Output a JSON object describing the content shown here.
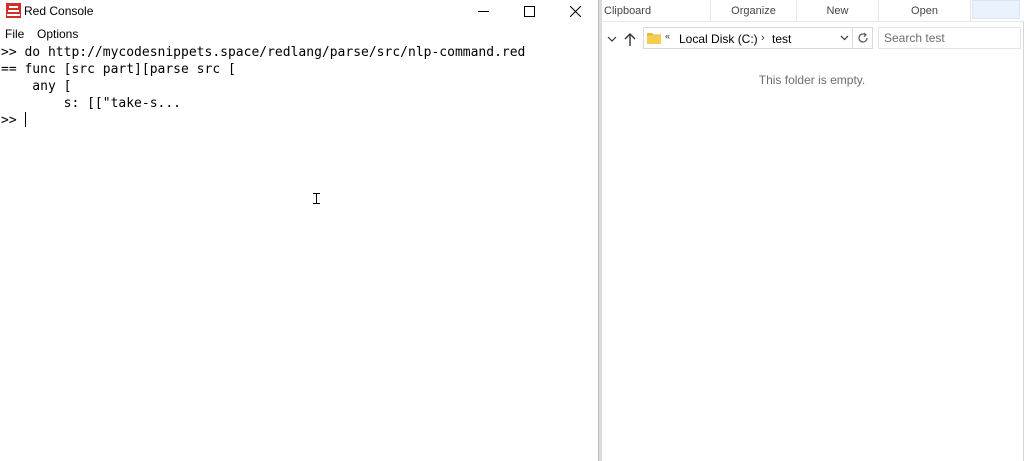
{
  "console": {
    "title": "Red Console",
    "menu": [
      {
        "label": "File"
      },
      {
        "label": "Options"
      }
    ],
    "lines": [
      ">> do http://mycodesnippets.space/redlang/parse/src/nlp-command.red",
      "== func [src part][parse src [",
      "    any [",
      "        s: [[\"take-s...",
      ">>"
    ],
    "colors": {
      "icon": "#d22f27"
    }
  },
  "explorer": {
    "ribbon": [
      {
        "label": "Clipboard"
      },
      {
        "label": "Organize"
      },
      {
        "label": "New"
      },
      {
        "label": "Open"
      }
    ],
    "address": {
      "more": "«",
      "disk": "Local Disk (C:)",
      "separator": "›",
      "folder": "test"
    },
    "search_placeholder": "Search test",
    "empty_message": "This folder is empty."
  }
}
